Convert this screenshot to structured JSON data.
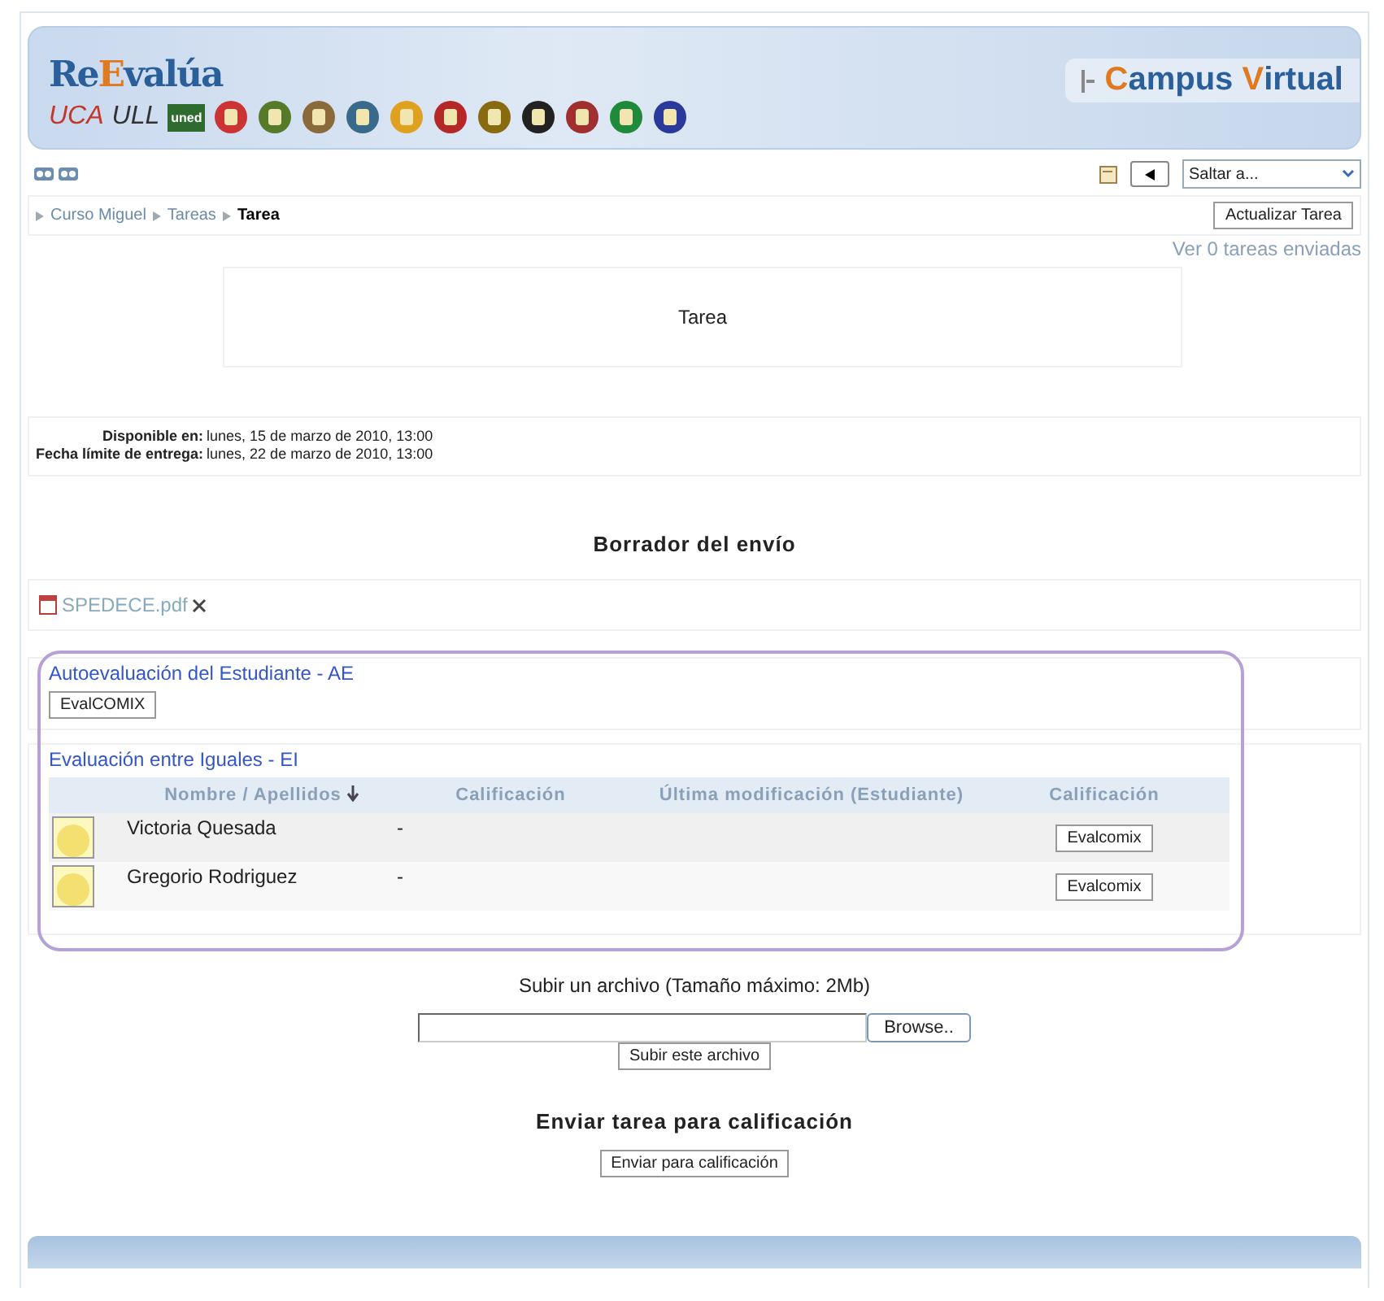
{
  "header": {
    "brand": [
      {
        "text": "Re",
        "accent": false
      },
      {
        "text": "E",
        "accent": true
      },
      {
        "text": "valúa",
        "accent": false
      }
    ],
    "logos": [
      {
        "kind": "text",
        "label": "UCA",
        "color": "#c0392b"
      },
      {
        "kind": "text",
        "label": "ULL",
        "color": "#333333"
      },
      {
        "kind": "badge",
        "label": "uned",
        "color": "#2e6b2e"
      },
      {
        "kind": "emblem",
        "color": "#cc3333"
      },
      {
        "kind": "emblem",
        "color": "#557a2a"
      },
      {
        "kind": "emblem",
        "color": "#8a6a3a"
      },
      {
        "kind": "emblem",
        "color": "#3a6a8a"
      },
      {
        "kind": "emblem",
        "color": "#e0a020"
      },
      {
        "kind": "emblem",
        "color": "#b52828"
      },
      {
        "kind": "emblem",
        "color": "#8a6a10"
      },
      {
        "kind": "emblem",
        "color": "#222222"
      },
      {
        "kind": "emblem",
        "color": "#a03030"
      },
      {
        "kind": "emblem",
        "color": "#1f8a3a"
      },
      {
        "kind": "emblem",
        "color": "#2a3a9a"
      }
    ],
    "campus": [
      {
        "text": "C",
        "accent": true
      },
      {
        "text": "ampus ",
        "accent": false
      },
      {
        "text": "V",
        "accent": true
      },
      {
        "text": "irtual",
        "accent": false
      }
    ]
  },
  "toolbar": {
    "jump_select": "Saltar a..."
  },
  "breadcrumb": [
    {
      "label": "Curso Miguel",
      "current": false
    },
    {
      "label": "Tareas",
      "current": false
    },
    {
      "label": "Tarea",
      "current": true
    }
  ],
  "update_button": "Actualizar Tarea",
  "submissions_link": "Ver 0 tareas enviadas",
  "task_title": "Tarea",
  "dates": [
    {
      "label": "Disponible en:",
      "value": "lunes, 15 de marzo de 2010, 13:00"
    },
    {
      "label": "Fecha límite de entrega:",
      "value": "lunes, 22 de marzo de 2010, 13:00"
    }
  ],
  "draft_heading": "Borrador del envío",
  "draft_file": "SPEDECE.pdf",
  "self_assessment": {
    "title": "Autoevaluación del Estudiante - AE",
    "button": "EvalCOMIX"
  },
  "peer_assessment": {
    "title": "Evaluación entre Iguales - EI",
    "columns": [
      "Nombre / Apellidos",
      "Calificación",
      "Última modificación (Estudiante)",
      "Calificación"
    ],
    "rows": [
      {
        "name": "Victoria Quesada",
        "grade": "-",
        "button": "Evalcomix"
      },
      {
        "name": "Gregorio Rodriguez",
        "grade": "-",
        "button": "Evalcomix"
      }
    ]
  },
  "upload": {
    "label": "Subir un archivo (Tamaño máximo: 2Mb)",
    "browse": "Browse..",
    "button": "Subir este archivo"
  },
  "submit": {
    "heading": "Enviar tarea para calificación",
    "button": "Enviar para calificación"
  }
}
